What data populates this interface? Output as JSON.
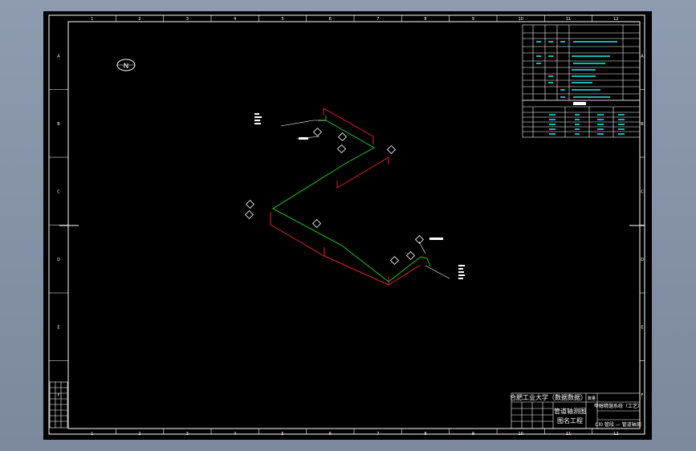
{
  "drawing": {
    "grid_columns": [
      "1",
      "2",
      "3",
      "4",
      "5",
      "6",
      "7",
      "8",
      "9",
      "10",
      "11",
      "12"
    ],
    "grid_rows": [
      "A",
      "B",
      "C",
      "D",
      "E",
      "F"
    ],
    "north_symbol": "N"
  },
  "title_block": {
    "school": "合肥工业大学（数据数据）",
    "drawing_title": "管道轴测图",
    "subtitle": "图名工程",
    "project": "甲醇精馏系统（工艺）",
    "sheet_title": "Cl0 管段 — 管道轴测",
    "code_label": "数量"
  },
  "colors": {
    "frame": "#ffffff",
    "pipe_green": "#19c819",
    "pipe_red": "#e02020",
    "table_text": "#18b4b4"
  }
}
